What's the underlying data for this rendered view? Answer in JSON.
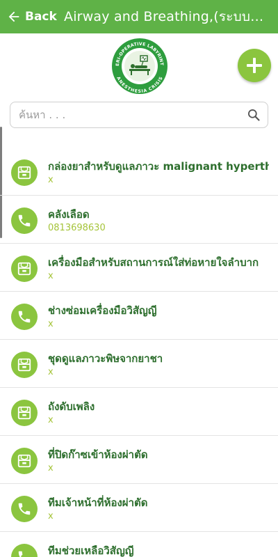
{
  "app_bar": {
    "back_label": "Back",
    "title": "Airway and Breathing,(ระบบก..."
  },
  "logo": {
    "top_text": "PERI-OPERATIVE LABYRINTH",
    "bottom_text": "ANESTHESIA CRISIS"
  },
  "search": {
    "placeholder": "ค้นหา . . ."
  },
  "colors": {
    "accent": "#5fb247",
    "icon_bg": "#8bc53f",
    "title_text": "#2e6f2e",
    "subtitle_text": "#a5c43a"
  },
  "items": [
    {
      "icon": "box-icon",
      "title": "กล่องยาสำหรับดูแลภาวะ malignant hyperthermia",
      "subtitle": "x"
    },
    {
      "icon": "phone-icon",
      "title": "คลังเลือด",
      "subtitle": "0813698630"
    },
    {
      "icon": "box-icon",
      "title": "เครื่องมือสำหรับสถานการณ์ใส่ท่อหายใจลำบาก",
      "subtitle": "x"
    },
    {
      "icon": "phone-icon",
      "title": "ช่างซ่อมเครื่องมือวิสัญญี",
      "subtitle": "x"
    },
    {
      "icon": "box-icon",
      "title": "ชุดดูแลภาวะพิษจากยาชา",
      "subtitle": "x"
    },
    {
      "icon": "box-icon",
      "title": "ถังดับเพลิง",
      "subtitle": "x"
    },
    {
      "icon": "box-icon",
      "title": "ที่ปิดก๊าซเข้าห้องผ่าตัด",
      "subtitle": "x"
    },
    {
      "icon": "phone-icon",
      "title": "ทีมเจ้าหน้าที่ห้องผ่าตัด",
      "subtitle": "x"
    },
    {
      "icon": "phone-icon",
      "title": "ทีมช่วยเหลือวิสัญญี",
      "subtitle": ""
    }
  ]
}
